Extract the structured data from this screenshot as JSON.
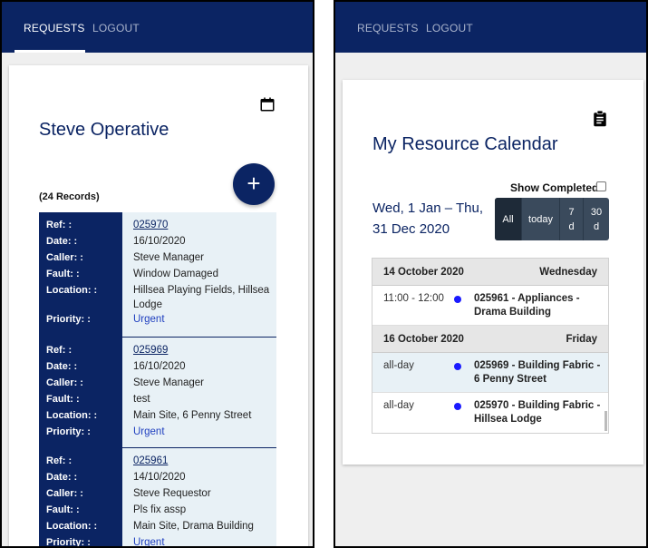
{
  "left": {
    "nav": {
      "requests": "REQUESTS",
      "logout": "LOGOUT"
    },
    "title": "Steve Operative",
    "calendar_icon": "calendar-icon",
    "add_icon": "plus-icon",
    "add_label": "+",
    "records_count": "(24 Records)",
    "labels": {
      "ref": "Ref: :",
      "date": "Date: :",
      "caller": "Caller: :",
      "fault": "Fault: :",
      "location": "Location: :",
      "priority": "Priority: :"
    },
    "records": [
      {
        "ref": "025970",
        "date": "16/10/2020",
        "caller": "Steve Manager",
        "fault": "Window Damaged",
        "location": "Hillsea Playing Fields, Hillsea Lodge",
        "priority": "Urgent"
      },
      {
        "ref": "025969",
        "date": "16/10/2020",
        "caller": "Steve Manager",
        "fault": "test",
        "location": "Main Site, 6 Penny Street",
        "priority": "Urgent"
      },
      {
        "ref": "025961",
        "date": "14/10/2020",
        "caller": "Steve Requestor",
        "fault": "Pls fix assp",
        "location": "Main Site, Drama Building",
        "priority": "Urgent"
      }
    ]
  },
  "right": {
    "nav": {
      "requests": "REQUESTS",
      "logout": "LOGOUT"
    },
    "title": "My Resource Calendar",
    "clipboard_icon": "clipboard-icon",
    "show_completed": "Show Completed",
    "date_range": "Wed, 1 Jan – Thu, 31 Dec 2020",
    "view_buttons": {
      "all": "All",
      "today": "today",
      "seven_d": "7\nd",
      "thirty_d": "30\nd"
    },
    "days": [
      {
        "date": "14 October 2020",
        "weekday": "Wednesday",
        "events": [
          {
            "time": "11:00 - 12:00",
            "title": "025961 - Appliances - Drama Building"
          }
        ]
      },
      {
        "date": "16 October 2020",
        "weekday": "Friday",
        "events": [
          {
            "time": "all-day",
            "title": "025969 - Building Fabric - 6 Penny Street"
          },
          {
            "time": "all-day",
            "title": "025970 - Building Fabric - Hillsea Lodge"
          }
        ]
      }
    ]
  },
  "colors": {
    "navy": "#0b2463",
    "row_bg": "#e8f1f6",
    "event_dot": "#1a1aff",
    "urgent": "#1f3fbf"
  }
}
